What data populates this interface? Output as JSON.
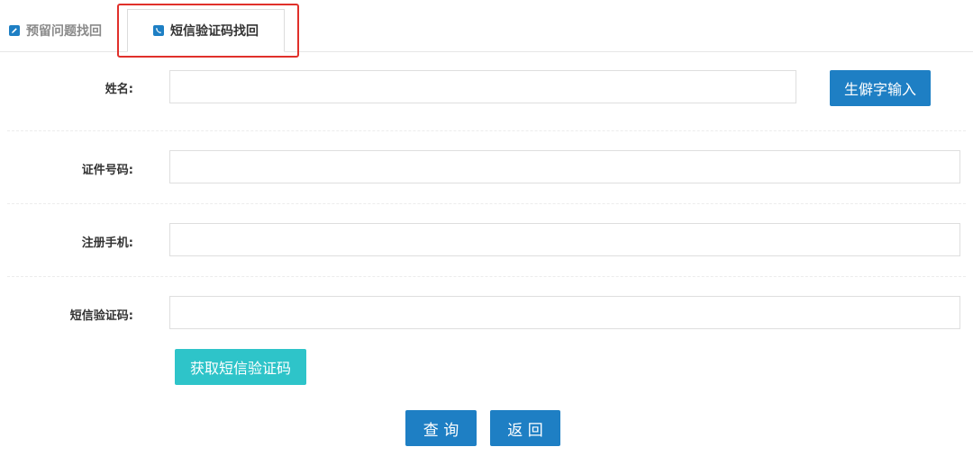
{
  "tabs": [
    {
      "label": "预留问题找回",
      "icon": "edit-icon",
      "active": false
    },
    {
      "label": "短信验证码找回",
      "icon": "phone-icon",
      "active": true
    }
  ],
  "form": {
    "name_label": "姓名:",
    "name_value": "",
    "rare_char_button": "生僻字输入",
    "id_label": "证件号码:",
    "id_value": "",
    "phone_label": "注册手机:",
    "phone_value": "",
    "sms_label": "短信验证码:",
    "sms_value": "",
    "get_sms_button": "获取短信验证码"
  },
  "actions": {
    "query_button": "查 询",
    "back_button": "返 回"
  },
  "colors": {
    "primary": "#1e7fc4",
    "teal": "#2ec4c9",
    "highlight": "#e0302a"
  }
}
